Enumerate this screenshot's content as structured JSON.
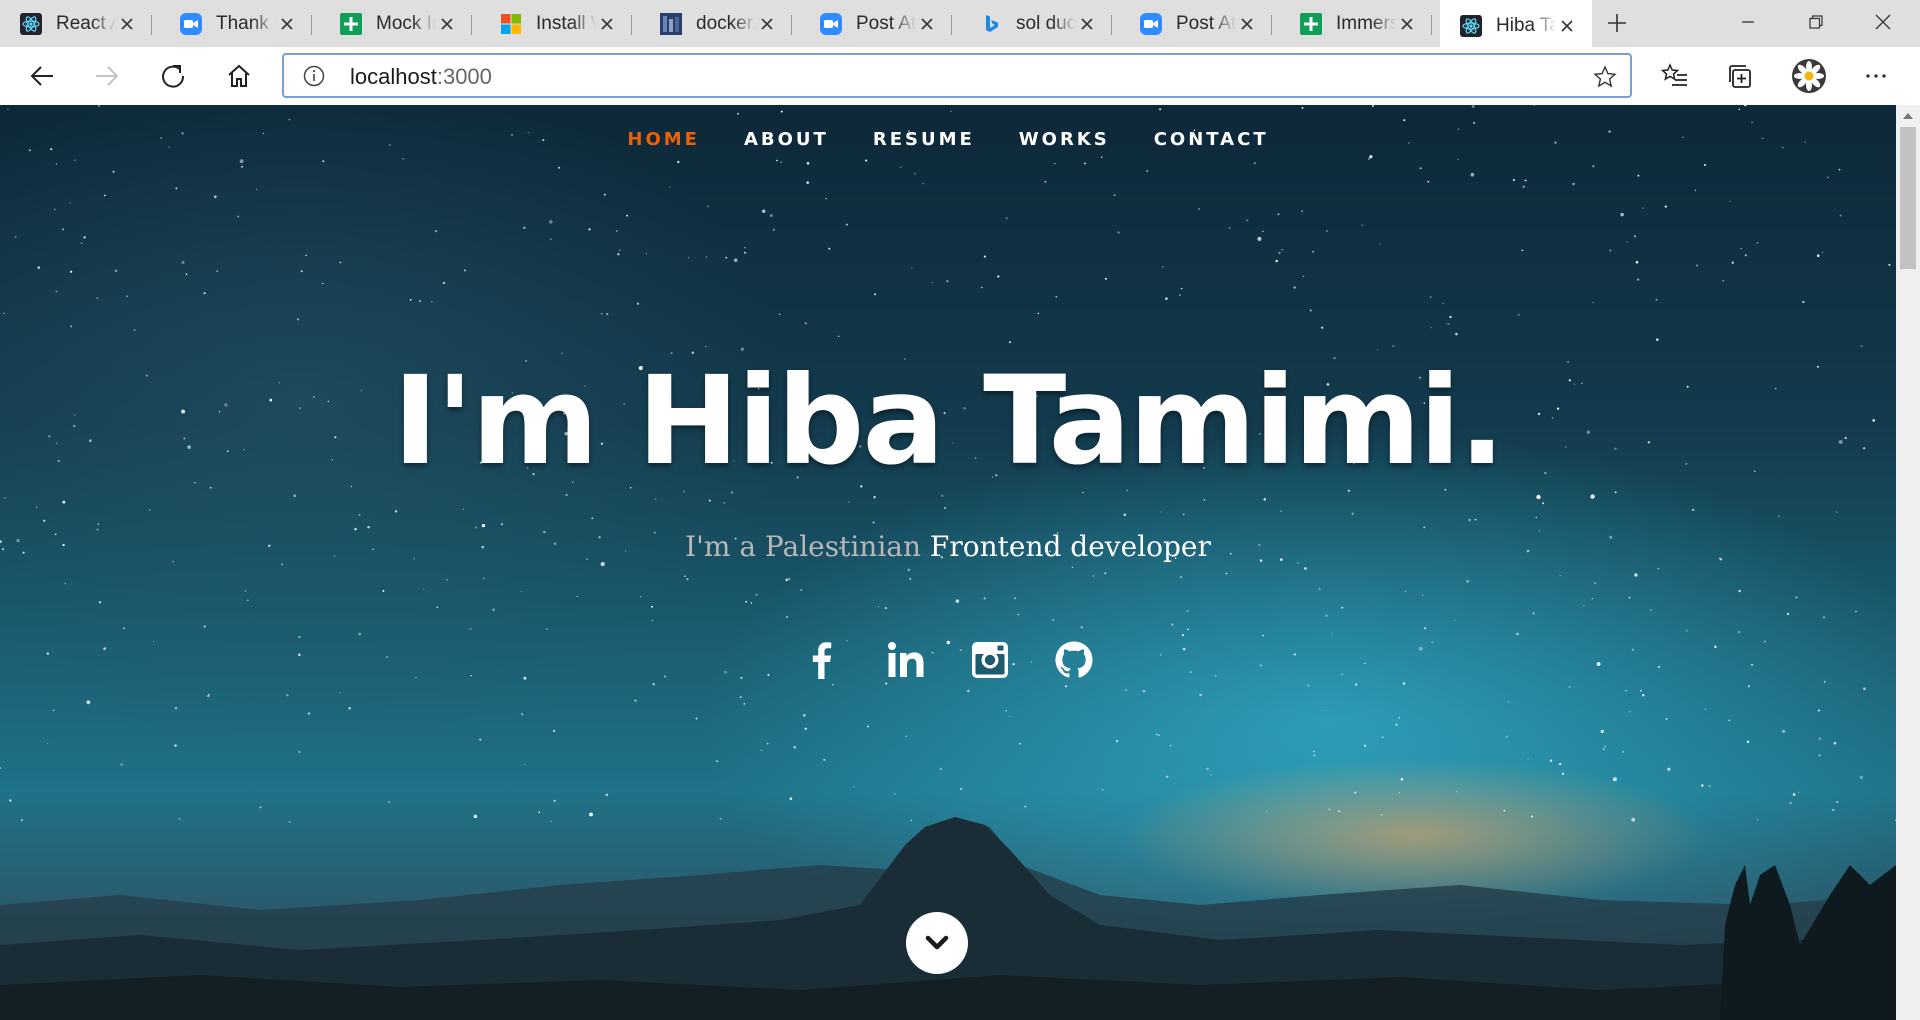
{
  "browser": {
    "tabs": [
      {
        "title": "React App",
        "icon": "react-icon"
      },
      {
        "title": "Thank you for registering",
        "icon": "zoom-icon"
      },
      {
        "title": "Mock Interview",
        "icon": "sheets-icon"
      },
      {
        "title": "Install Windows",
        "icon": "microsoft-icon"
      },
      {
        "title": "docker, ",
        "icon": "docker-thumb-icon"
      },
      {
        "title": "Post Attendee",
        "icon": "zoom-icon"
      },
      {
        "title": "sol duc",
        "icon": "bing-icon"
      },
      {
        "title": "Post Attendee",
        "icon": "zoom-icon"
      },
      {
        "title": "Immersive",
        "icon": "sheets-icon"
      },
      {
        "title": "Hiba Tamimi",
        "icon": "react-icon",
        "active": true
      }
    ],
    "address": {
      "host": "localhost",
      "port": ":3000"
    }
  },
  "page": {
    "nav": [
      "HOME",
      "ABOUT",
      "RESUME",
      "WORKS",
      "CONTACT"
    ],
    "nav_active_color": "#f06000",
    "hero_title": "I'm Hiba Tamimi.",
    "hero_sub_prefix": "I'm a Palestinian",
    "hero_sub_role": "Frontend developer",
    "social": [
      "facebook-icon",
      "linkedin-icon",
      "instagram-icon",
      "github-icon"
    ]
  }
}
